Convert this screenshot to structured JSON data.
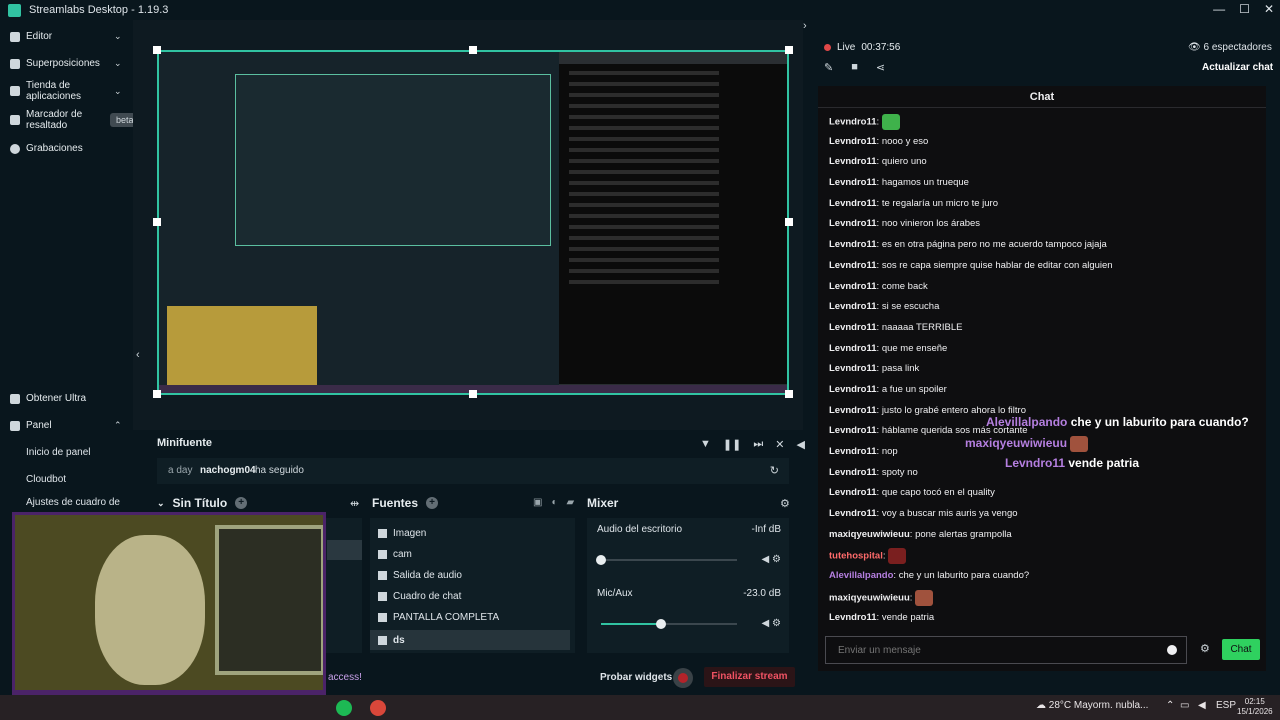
{
  "window": {
    "title": "Streamlabs Desktop - 1.19.3",
    "controls": [
      "—",
      "☐",
      "✕"
    ]
  },
  "sidebar": {
    "items": [
      {
        "label": "Editor"
      },
      {
        "label": "Superposiciones"
      },
      {
        "label": "Tienda de aplicaciones"
      },
      {
        "label": "Marcador de resaltado",
        "badge": "beta"
      },
      {
        "label": "Grabaciones"
      }
    ],
    "bottom": {
      "ultra": "Obtener Ultra",
      "panel": "Panel",
      "sub_items": [
        "Inicio de panel",
        "Cloudbot",
        "Ajustes de cuadro de"
      ]
    }
  },
  "editor": {
    "minifuente": {
      "title": "Minifuente",
      "event": {
        "when": "a day",
        "who": "nachogm04",
        "action": "ha seguido"
      }
    },
    "scenes": {
      "title": "Sin Título"
    },
    "sources": {
      "title": "Fuentes",
      "items": [
        {
          "label": "Imagen",
          "icon": "image-icon"
        },
        {
          "label": "cam",
          "icon": "camera-icon"
        },
        {
          "label": "Salida de audio",
          "icon": "speaker-icon"
        },
        {
          "label": "Cuadro de chat",
          "icon": "chat-icon"
        },
        {
          "label": "PANTALLA COMPLETA",
          "icon": "monitor-icon"
        },
        {
          "label": "ds",
          "icon": "list-icon",
          "active": true
        }
      ]
    },
    "mixer": {
      "title": "Mixer",
      "channels": [
        {
          "name": "Audio del escritorio",
          "db": "-Inf dB",
          "level": 0.0
        },
        {
          "name": "Mic/Aux",
          "db": "-23.0 dB",
          "level": 0.44
        }
      ]
    },
    "bottom": {
      "access_text": "access!",
      "test_widgets": "Probar widgets",
      "end_stream": "Finalizar stream"
    }
  },
  "live": {
    "status": "Live",
    "duration": "00:37:56",
    "viewers": "6 espectadores",
    "refresh_chat": "Actualizar chat"
  },
  "chat": {
    "header": "Chat",
    "messages": [
      {
        "user": "Levndro11",
        "text": "",
        "color": "#efeff1",
        "emote": "#3fb24b"
      },
      {
        "user": "Levndro11",
        "text": "nooo y eso",
        "color": "#efeff1"
      },
      {
        "user": "Levndro11",
        "text": "quiero uno",
        "color": "#efeff1"
      },
      {
        "user": "Levndro11",
        "text": "hagamos un trueque",
        "color": "#efeff1"
      },
      {
        "user": "Levndro11",
        "text": "te regalaría un micro te juro",
        "color": "#efeff1"
      },
      {
        "user": "Levndro11",
        "text": "noo vinieron los árabes",
        "color": "#efeff1"
      },
      {
        "user": "Levndro11",
        "text": "es en otra página pero no me acuerdo tampoco jajaja",
        "color": "#efeff1"
      },
      {
        "user": "Levndro11",
        "text": "sos re capa siempre quise hablar de editar con alguien",
        "color": "#efeff1"
      },
      {
        "user": "Levndro11",
        "text": "come back",
        "color": "#efeff1"
      },
      {
        "user": "Levndro11",
        "text": "si se escucha",
        "color": "#efeff1"
      },
      {
        "user": "Levndro11",
        "text": "naaaaa TERRIBLE",
        "color": "#efeff1"
      },
      {
        "user": "Levndro11",
        "text": "que me enseñe",
        "color": "#efeff1"
      },
      {
        "user": "Levndro11",
        "text": "pasa link",
        "color": "#efeff1"
      },
      {
        "user": "Levndro11",
        "text": "a fue un spoiler",
        "color": "#efeff1"
      },
      {
        "user": "Levndro11",
        "text": "justo lo grabé entero ahora lo filtro",
        "color": "#efeff1"
      },
      {
        "user": "Levndro11",
        "text": "háblame querida sos más cortante",
        "color": "#efeff1"
      },
      {
        "user": "Levndro11",
        "text": "nop",
        "color": "#efeff1"
      },
      {
        "user": "Levndro11",
        "text": "spoty no",
        "color": "#efeff1"
      },
      {
        "user": "Levndro11",
        "text": "que capo tocó en el quality",
        "color": "#efeff1"
      },
      {
        "user": "Levndro11",
        "text": "voy a buscar mis auris ya vengo",
        "color": "#efeff1"
      },
      {
        "user": "maxiqyeuwiwieuu",
        "text": "pone alertas grampolla",
        "color": "#efeff1"
      },
      {
        "user": "tutehospital",
        "text": "",
        "color": "#ff6b6b",
        "emote": "#7a1f1f"
      },
      {
        "user": "Alevillalpando",
        "text": "che y un laburito para cuando?",
        "color": "#b57fe0"
      },
      {
        "user": "maxiqyeuwiwieuu",
        "text": "",
        "color": "#efeff1",
        "emote": "#a0523d"
      },
      {
        "user": "Levndro11",
        "text": "vende patria",
        "color": "#efeff1"
      }
    ],
    "overlay": [
      {
        "user": "Alevillalpando",
        "text": "che y un laburito para cuando?"
      },
      {
        "user": "maxiqyeuwiwieuu",
        "text": ""
      },
      {
        "user": "Levndro11",
        "text": "vende patria"
      }
    ],
    "input_placeholder": "Enviar un mensaje",
    "send_label": "Chat"
  },
  "taskbar": {
    "weather": "28°C  Mayorm. nubla...",
    "lang": "ESP",
    "time": "02:15",
    "date": "15/1/2026"
  }
}
